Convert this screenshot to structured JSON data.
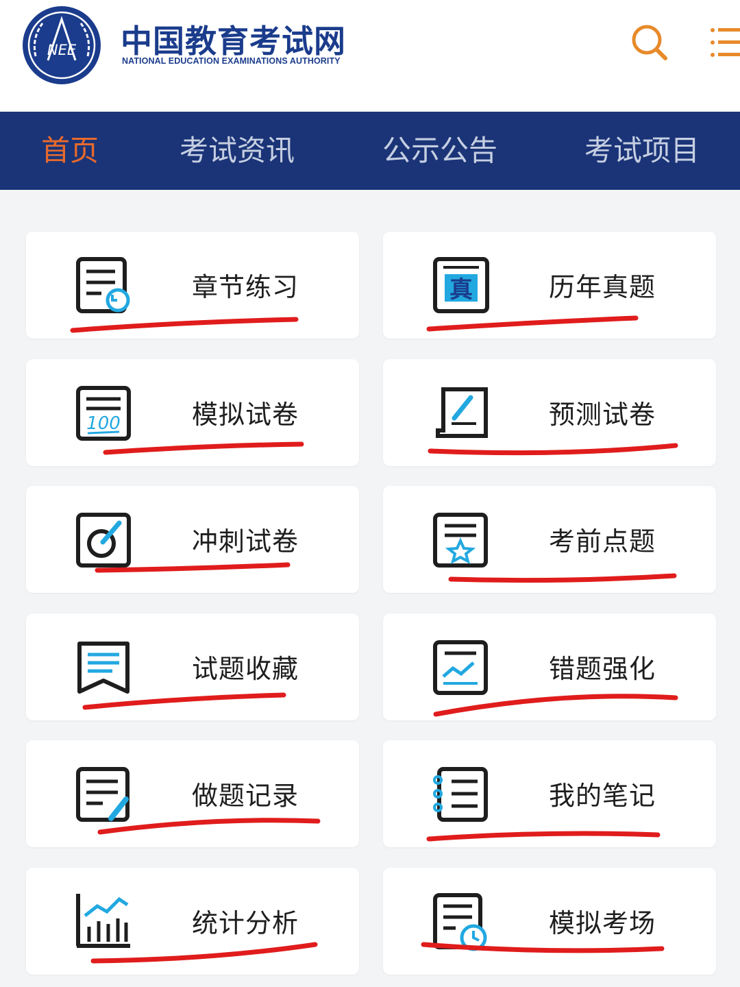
{
  "header": {
    "title": "中国教育考试网",
    "subtitle": "NATIONAL EDUCATION EXAMINATIONS AUTHORITY",
    "logo_text": "NEE"
  },
  "nav": {
    "items": [
      {
        "label": "首页",
        "active": true
      },
      {
        "label": "考试资讯",
        "active": false
      },
      {
        "label": "公示公告",
        "active": false
      },
      {
        "label": "考试项目",
        "active": false
      }
    ]
  },
  "features": [
    {
      "label": "章节练习",
      "icon": "chapter-practice-icon"
    },
    {
      "label": "历年真题",
      "icon": "past-papers-icon",
      "icon_text": "真"
    },
    {
      "label": "模拟试卷",
      "icon": "mock-paper-icon",
      "icon_text": "100"
    },
    {
      "label": "预测试卷",
      "icon": "prediction-paper-icon"
    },
    {
      "label": "冲刺试卷",
      "icon": "sprint-paper-icon"
    },
    {
      "label": "考前点题",
      "icon": "key-topics-icon"
    },
    {
      "label": "试题收藏",
      "icon": "bookmark-icon"
    },
    {
      "label": "错题强化",
      "icon": "mistake-review-icon"
    },
    {
      "label": "做题记录",
      "icon": "practice-record-icon"
    },
    {
      "label": "我的笔记",
      "icon": "notebook-icon"
    },
    {
      "label": "统计分析",
      "icon": "statistics-icon"
    },
    {
      "label": "模拟考场",
      "icon": "mock-exam-icon"
    }
  ],
  "colors": {
    "brand_blue": "#1b3c8c",
    "nav_bg": "#1b3477",
    "active_orange": "#e86a2c",
    "icon_cyan": "#22a8e0",
    "annotation_red": "#e01c1c"
  }
}
